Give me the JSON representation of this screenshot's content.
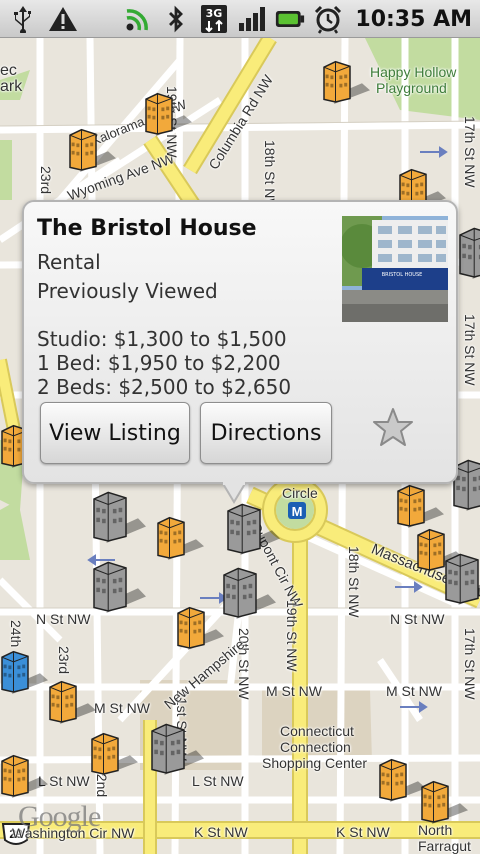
{
  "status_bar": {
    "time": "10:35 AM",
    "icons": [
      "usb-icon",
      "warning-icon",
      "signal-icon",
      "bluetooth-icon",
      "3g-icon",
      "cell-signal-icon",
      "battery-icon",
      "alarm-icon"
    ],
    "network_label": "3G"
  },
  "map": {
    "labels": {
      "happy_hollow": "Happy Hollow",
      "playground": "Playground",
      "columbia_rd": "Columbia Rd NW",
      "kalorama_rd": "Kalorama Rd NW",
      "wyoming_ave": "Wyoming Ave NW",
      "st_18th_top": "18th St NW",
      "st_19th_top": "19th St NW",
      "st_17th_top": "17th St NW",
      "st_23rd": "23rd",
      "st_17th_mid": "17th St NW",
      "st_17th_low": "17th St NW",
      "circle": "Circle",
      "dupont_cir": "Dupont Cir NW",
      "massachusetts_ave": "Massachusetts Av",
      "st_18th": "18th St NW",
      "st_19th": "19th St NW",
      "st_20th": "20th St NW",
      "st_21st": "21st St NW",
      "st_22nd": "22nd",
      "st_23rd_low": "23rd",
      "st_24th": "24th",
      "new_hampshire": "New Hampshire",
      "n_st_left": "N St NW",
      "n_st_right": "N St NW",
      "m_st_mid": "M St NW",
      "m_st_right": "M St NW",
      "m_st_left": "M St NW",
      "l_st": "L St NW",
      "l_st_left": "L St NW",
      "connecticut": "Connecticut",
      "connection": "Connection",
      "shopping_center": "Shopping Center",
      "k_st_mid": "K St NW",
      "k_st_right": "K St NW",
      "washington_cir": "Washington Cir NW",
      "north": "North",
      "farragut": "Farragut",
      "route_29": "29",
      "metro": "M",
      "google": "Google",
      "ec": "ec",
      "ark": "ark"
    }
  },
  "bubble": {
    "title": "The Bristol House",
    "type": "Rental",
    "status": "Previously Viewed",
    "prices": [
      "Studio: $1,300 to $1,500",
      "1 Bed: $1,950 to $2,200",
      "2 Beds: $2,500 to $2,650"
    ],
    "view_listing_label": "View Listing",
    "directions_label": "Directions",
    "photo_sign": "BRISTOL HOUSE"
  },
  "colors": {
    "major_road": "#f9ec7a",
    "road_border": "#d9c95a",
    "minor_road": "#ffffff",
    "park": "#c2dca0",
    "map_bg": "#e9e5dc",
    "marker_orange": "#f2a93b",
    "marker_gray": "#9a9a9a",
    "marker_blue": "#3b8fd8"
  }
}
